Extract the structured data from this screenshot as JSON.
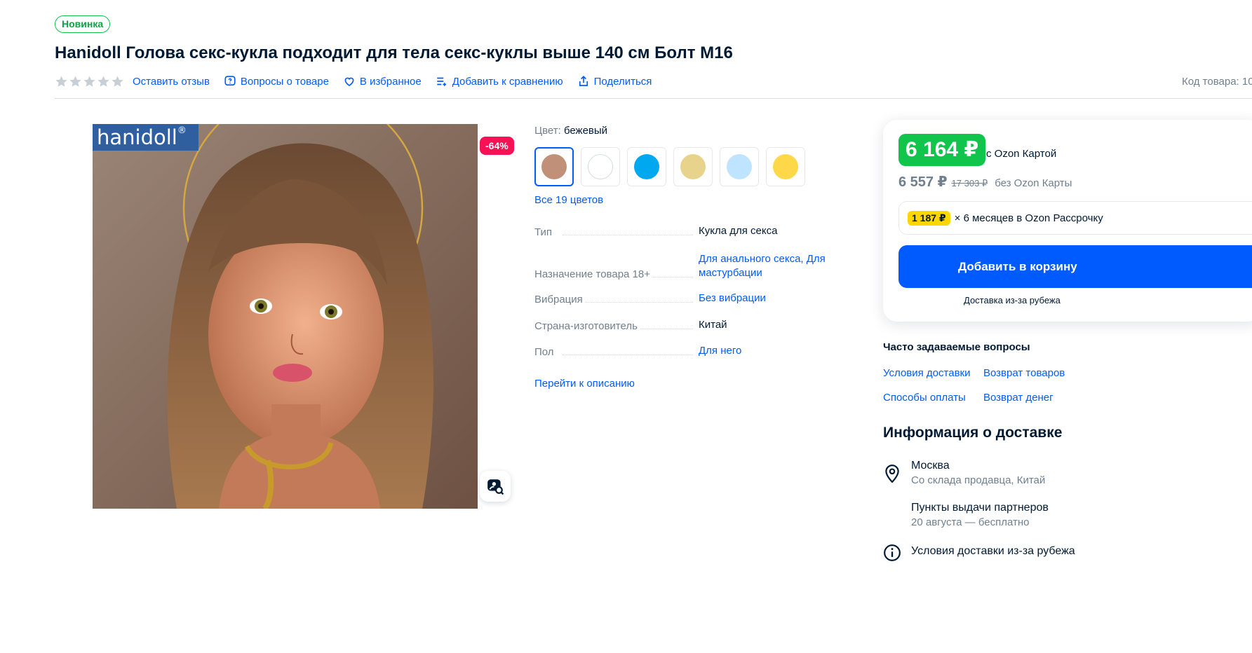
{
  "product": {
    "badge": "Новинка",
    "title": "Hanidoll Голова секс-кукла подходит для тела секс-куклы выше 140 см Болт M16",
    "sku_label": "Код товара: 10",
    "discount": "-64%",
    "brand_logo": "hanidoll",
    "brand_mark": "®"
  },
  "actions": {
    "review": "Оставить отзыв",
    "questions": "Вопросы о товаре",
    "favorite": "В избранное",
    "compare": "Добавить к сравнению",
    "share": "Поделиться"
  },
  "color": {
    "label": "Цвет:",
    "value": "бежевый",
    "swatches": [
      "#c09078",
      "#ffffff",
      "#00a8f0",
      "#e8d38c",
      "#bfe4ff",
      "#ffd84a"
    ],
    "all_colors": "Все 19 цветов"
  },
  "specs": [
    {
      "key": "Тип",
      "value": "Кукла для секса",
      "link": false
    },
    {
      "key": "Назначение товара 18+",
      "value": "Для анального секса, Для мастурбации",
      "link": true
    },
    {
      "key": "Вибрация",
      "value": "Без вибрации",
      "link": true
    },
    {
      "key": "Страна-изготовитель",
      "value": "Китай",
      "link": false
    },
    {
      "key": "Пол",
      "value": "Для него",
      "link": true
    }
  ],
  "go_to_description": "Перейти к описанию",
  "price": {
    "card_price": "6 164 ₽",
    "card_label": "с Ozon Картой",
    "regular_price": "6 557 ₽",
    "old_price": "17 303 ₽",
    "regular_label": "без Ozon Карты",
    "installment_amount": "1 187 ₽",
    "installment_text": "× 6 месяцев в Ozon Рассрочку",
    "add_to_cart": "Добавить в корзину",
    "delivery_note": "Доставка из-за рубежа"
  },
  "faq": {
    "title": "Часто задаваемые вопросы",
    "items": [
      "Условия доставки",
      "Возврат товаров",
      "Способы оплаты",
      "Возврат денег"
    ]
  },
  "delivery": {
    "title": "Информация о доставке",
    "city": "Москва",
    "city_sub": "Со склада продавца, Китай",
    "pickup": "Пункты выдачи партнеров",
    "pickup_sub": "20 августа — бесплатно",
    "abroad_terms": "Условия доставки из-за рубежа"
  },
  "colors": {
    "accent": "#005bff",
    "price_green": "#10c44c",
    "discount_red": "#f91155",
    "installment_yellow": "#ffd600"
  },
  "icons": [
    "star-icon",
    "question-icon",
    "heart-icon",
    "compare-icon",
    "share-icon",
    "image-search-icon",
    "location-pin-icon",
    "info-icon"
  ]
}
